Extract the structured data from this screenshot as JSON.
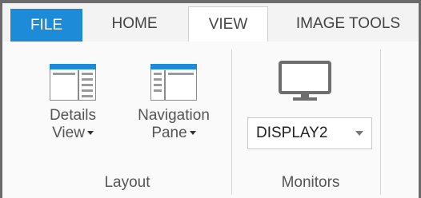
{
  "tabs": {
    "file": "FILE",
    "home": "HOME",
    "view": "VIEW",
    "image_tools": "IMAGE TOOLS"
  },
  "layout_group": {
    "details_view": {
      "line1": "Details",
      "line2": "View"
    },
    "navigation_pane": {
      "line1": "Navigation",
      "line2": "Pane"
    },
    "label": "Layout"
  },
  "monitors_group": {
    "display_select_value": "DISPLAY2",
    "label": "Monitors"
  },
  "colors": {
    "file_tab_bg": "#1e8bd8",
    "icon_blue": "#1e8bd8",
    "icon_gray": "#6e6e6e"
  }
}
